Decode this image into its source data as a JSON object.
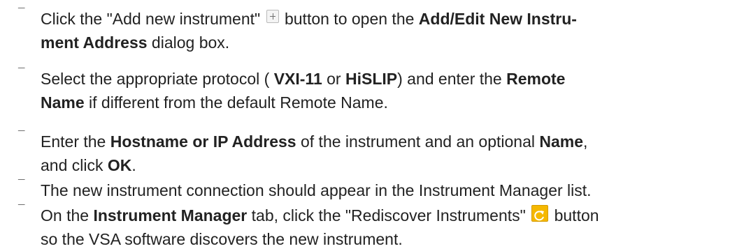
{
  "bullet_glyph": "¯",
  "icons": {
    "add_new_instrument": "plus-icon",
    "rediscover_instruments": "refresh-icon",
    "accent_color": "#f5b800"
  },
  "steps": [
    {
      "lines": [
        [
          "Click the \"Add new instrument\" ",
          "[plus-icon]",
          " button to open the ",
          {
            "b": "Add/Edit New Instru-"
          }
        ],
        [
          {
            "b": "ment Address"
          },
          " dialog box."
        ]
      ]
    },
    {
      "lines": [
        [
          "Select the appropriate protocol ( ",
          {
            "b": "VXI-11"
          },
          " or ",
          {
            "b": "HiSLIP"
          },
          ") and enter the ",
          {
            "b": "Remote"
          }
        ],
        [
          {
            "b": "Name"
          },
          " if different from the default Remote Name."
        ]
      ]
    },
    {
      "lines": [
        [
          "Enter the ",
          {
            "b": "Hostname or IP Address"
          },
          " of the instrument and an optional ",
          {
            "b": "Name"
          },
          ","
        ],
        [
          "and click ",
          {
            "b": "OK"
          },
          "."
        ]
      ]
    },
    {
      "lines": [
        [
          "The new instrument connection should appear in the Instrument Manager list."
        ]
      ]
    },
    {
      "lines": [
        [
          "On the ",
          {
            "b": "Instrument Manager"
          },
          " tab, click the \"Rediscover Instruments\" ",
          "[refresh-icon]",
          " button"
        ],
        [
          "so the VSA software discovers the new instrument."
        ]
      ]
    }
  ]
}
